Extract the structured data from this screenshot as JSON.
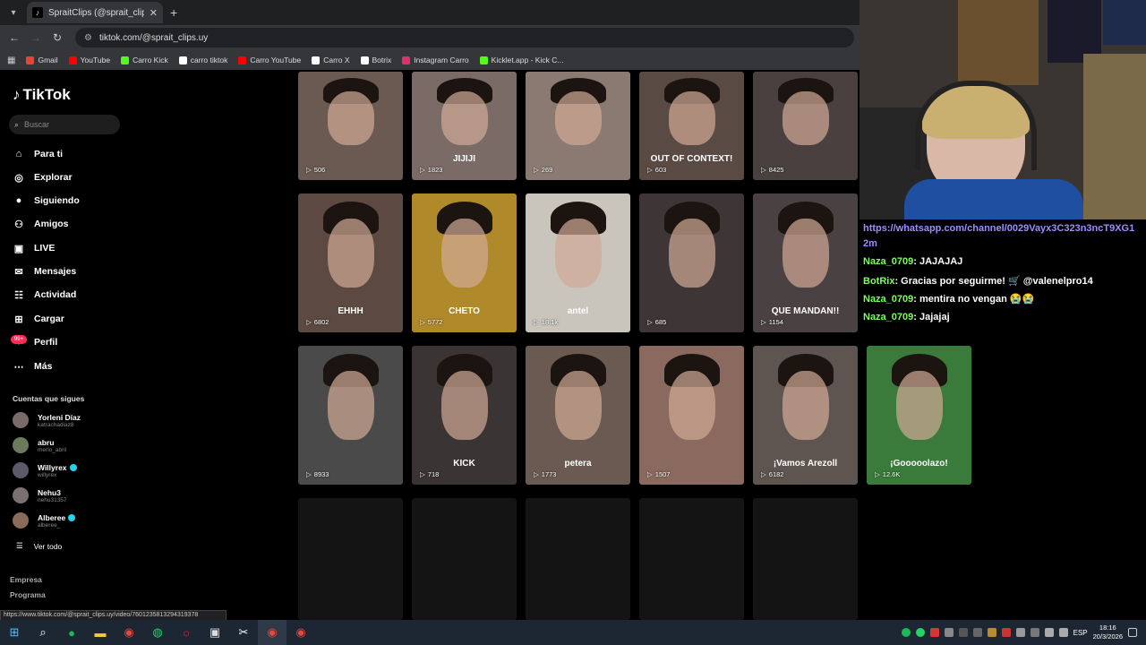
{
  "browser": {
    "tab_title": "SpraitClips (@sprait_clips.uy) | T",
    "tab_icon": "tiktok-icon",
    "url": "tiktok.com/@sprait_clips.uy",
    "bookmarks": [
      {
        "label": "Gmail",
        "color": "#ea4335"
      },
      {
        "label": "YouTube",
        "color": "#ff0000"
      },
      {
        "label": "Carro Kick",
        "color": "#53fc18"
      },
      {
        "label": "carro tiktok",
        "color": "#ffffff"
      },
      {
        "label": "Carro YouTube",
        "color": "#ff0000"
      },
      {
        "label": "Carro X",
        "color": "#ffffff"
      },
      {
        "label": "Botrix",
        "color": "#ffffff"
      },
      {
        "label": "Instagram Carro",
        "color": "#e1306c"
      },
      {
        "label": "Kicklet.app - Kick C...",
        "color": "#53fc18"
      }
    ],
    "status_url": "https://www.tiktok.com/@sprait_clips.uy/video/7601235813294319378"
  },
  "sidebar": {
    "logo": "TikTok",
    "search_placeholder": "Buscar",
    "nav": [
      {
        "label": "Para ti",
        "icon": "home-icon"
      },
      {
        "label": "Explorar",
        "icon": "compass-icon"
      },
      {
        "label": "Siguiendo",
        "icon": "following-avatar-icon"
      },
      {
        "label": "Amigos",
        "icon": "friends-icon"
      },
      {
        "label": "LIVE",
        "icon": "live-icon"
      },
      {
        "label": "Mensajes",
        "icon": "messages-icon"
      },
      {
        "label": "Actividad",
        "icon": "activity-icon"
      },
      {
        "label": "Cargar",
        "icon": "upload-icon"
      },
      {
        "label": "Perfil",
        "icon": "profile-avatar-icon"
      },
      {
        "label": "Más",
        "icon": "more-icon"
      }
    ],
    "messages_badge": "99+",
    "following_title": "Cuentas que sigues",
    "accounts": [
      {
        "name": "Yorleni Díaz",
        "user": "katrachadiaz8",
        "verified": false
      },
      {
        "name": "abru",
        "user": "merlo_abril",
        "verified": false
      },
      {
        "name": "Willyrex",
        "user": "willyrex",
        "verified": true
      },
      {
        "name": "Nehu3",
        "user": "nehu31357",
        "verified": false
      },
      {
        "name": "Alberee",
        "user": "alberee_",
        "verified": true
      }
    ],
    "see_all": "Ver todo",
    "footer": [
      "Empresa",
      "Programa"
    ]
  },
  "videos": [
    {
      "views": "506",
      "caption": "",
      "bg": "#6b5a52"
    },
    {
      "views": "1823",
      "caption": "JIJIJI",
      "bg": "#7a6b66"
    },
    {
      "views": "269",
      "caption": "",
      "bg": "#8a7a72"
    },
    {
      "views": "603",
      "caption": "OUT OF CONTEXT!",
      "bg": "#5a4a44"
    },
    {
      "views": "8425",
      "caption": "",
      "bg": "#4a4040"
    },
    {
      "views": "6802",
      "caption": "EHHH",
      "bg": "#5c4a42"
    },
    {
      "views": "5772",
      "caption": "CHETO",
      "bg": "#b08a2a"
    },
    {
      "views": "18.1k",
      "caption": "antel",
      "bg": "#c9c4bc"
    },
    {
      "views": "685",
      "caption": "",
      "bg": "#3e3636"
    },
    {
      "views": "1154",
      "caption": "QUE MANDAN!!",
      "bg": "#4a4242"
    },
    {
      "views": "8933",
      "caption": "",
      "bg": "#4a4a4a"
    },
    {
      "views": "718",
      "caption": "KICK",
      "bg": "#3a3434"
    },
    {
      "views": "1773",
      "caption": "petera",
      "bg": "#6a5a52"
    },
    {
      "views": "1507",
      "caption": "",
      "bg": "#8a6a5e"
    },
    {
      "views": "6182",
      "caption": "¡Vamos Arezoll",
      "bg": "#5e5450"
    },
    {
      "views": "12.6K",
      "caption": "¡Gooooolazo!",
      "bg": "#3a7a3a"
    }
  ],
  "stream_chat": [
    {
      "user": "",
      "text": "https://whatsapp.com/channel/0029Vayx3C323n3ncT9XG1",
      "link": true
    },
    {
      "user": "",
      "text": "2m",
      "link": true
    },
    {
      "user": "Naza_0709",
      "text": ": JAJAJAJ"
    },
    {
      "user": "BotRix",
      "text": ": Gracias por seguirme! 🛒 @valenelpro14"
    },
    {
      "user": "Naza_0709",
      "text": ": mentira no vengan 😭😭"
    },
    {
      "user": "Naza_0709",
      "text": ": Jajajaj"
    }
  ],
  "taskbar": {
    "lang": "ESP",
    "time": "18:16",
    "date": "20/3/2026"
  }
}
